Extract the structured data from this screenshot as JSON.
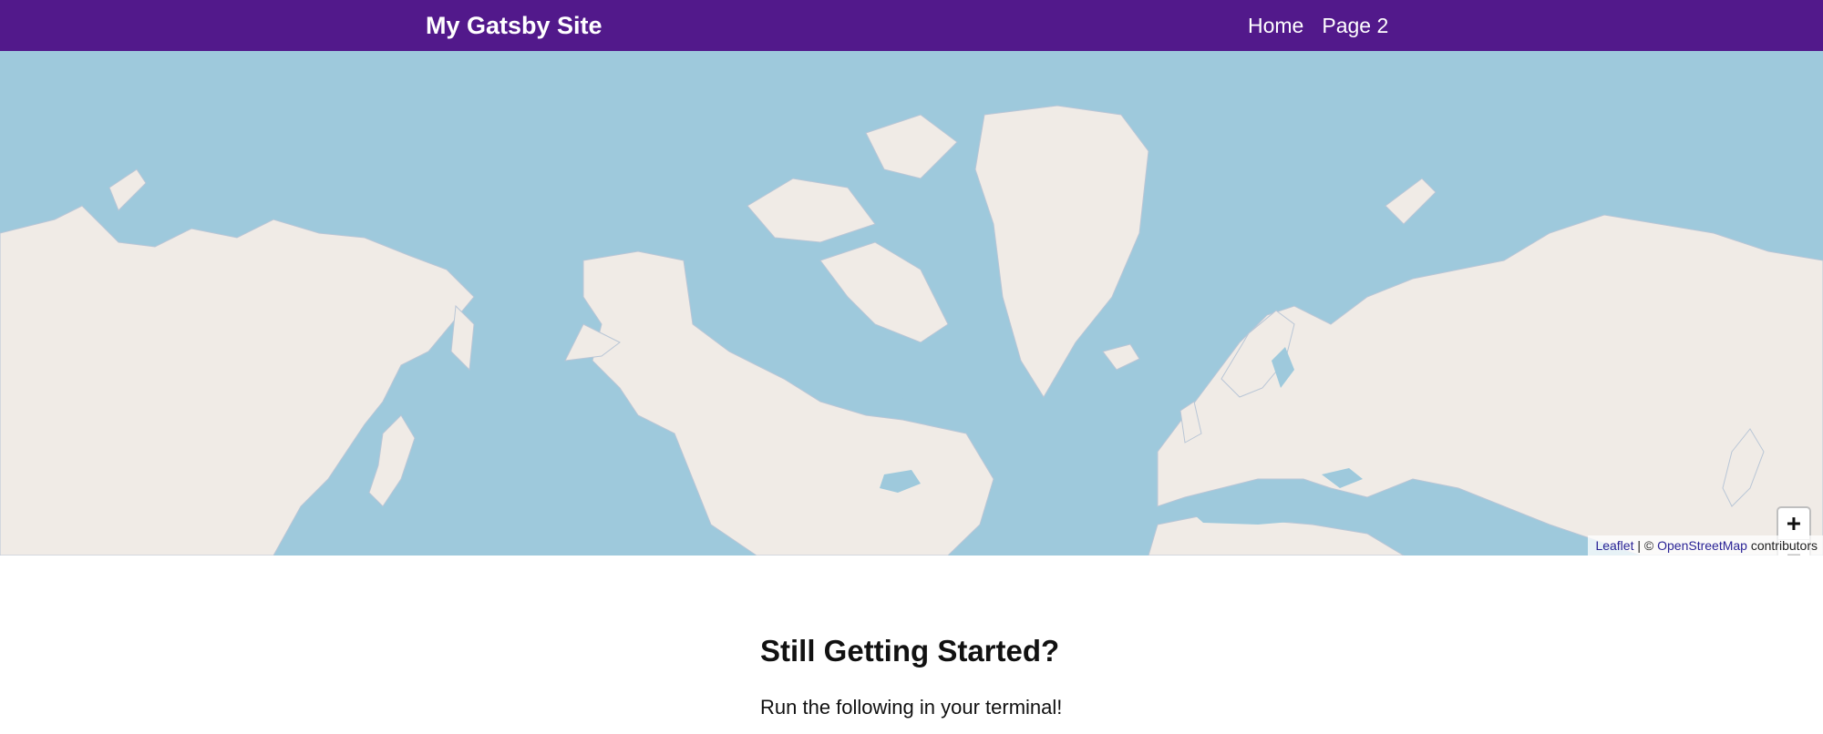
{
  "header": {
    "site_title": "My Gatsby Site",
    "nav": [
      {
        "label": "Home"
      },
      {
        "label": "Page 2"
      }
    ],
    "background_color": "#52198b"
  },
  "map": {
    "water_color": "#9ec9dc",
    "land_color": "#f0ebe6",
    "zoom_in_label": "+",
    "zoom_out_label": "−",
    "attribution": {
      "leaflet_link": "Leaflet",
      "separator": " | © ",
      "osm_link": "OpenStreetMap",
      "suffix": " contributors"
    }
  },
  "content": {
    "title": "Still Getting Started?",
    "text": "Run the following in your terminal!"
  }
}
